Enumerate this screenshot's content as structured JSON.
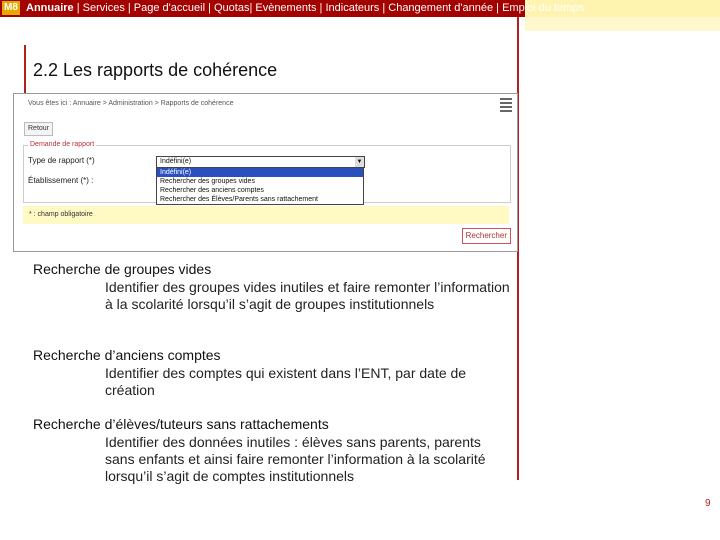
{
  "header": {
    "logo": "M8",
    "nav": [
      {
        "label": "Annuaire",
        "strong": true
      },
      {
        "label": " |  Services | Page d'accueil | Quotas| Evènements | Indicateurs |   Changement d'année  | Emploi du temps",
        "strong": false
      }
    ]
  },
  "title": "2.2 Les rapports de cohérence",
  "screenshot": {
    "breadcrumb": "Vous êtes ici : Annuaire > Administration > Rapports de cohérence",
    "retour": "Retour",
    "legend": "Demande de rapport",
    "type_label": "Type de rapport (*)",
    "etab_label": "Établissement (*) :",
    "select_value": "Indéfini(e)",
    "options": [
      "Indéfini(e)",
      "Rechercher des groupes vides",
      "Rechercher des anciens comptes",
      "Rechercher des Élèves/Parents sans rattachement"
    ],
    "required": "* : champ obligatoire",
    "rechercher": "Rechercher"
  },
  "items": [
    {
      "title": "Recherche de groupes vides",
      "desc": "Identifier des groupes vides inutiles et faire remonter l’information à la scolarité lorsqu’il s’agit de groupes institutionnels"
    },
    {
      "title": "Recherche d’anciens comptes",
      "desc": "Identifier des comptes qui existent dans l’ENT, par date de création"
    },
    {
      "title": "Recherche d’élèves/tuteurs sans rattachements",
      "desc": "Identifier des données inutiles : élèves sans parents, parents sans enfants et ainsi faire remonter l’information à la scolarité lorsqu’il s’agit de comptes institutionnels"
    }
  ],
  "page_number": "9"
}
